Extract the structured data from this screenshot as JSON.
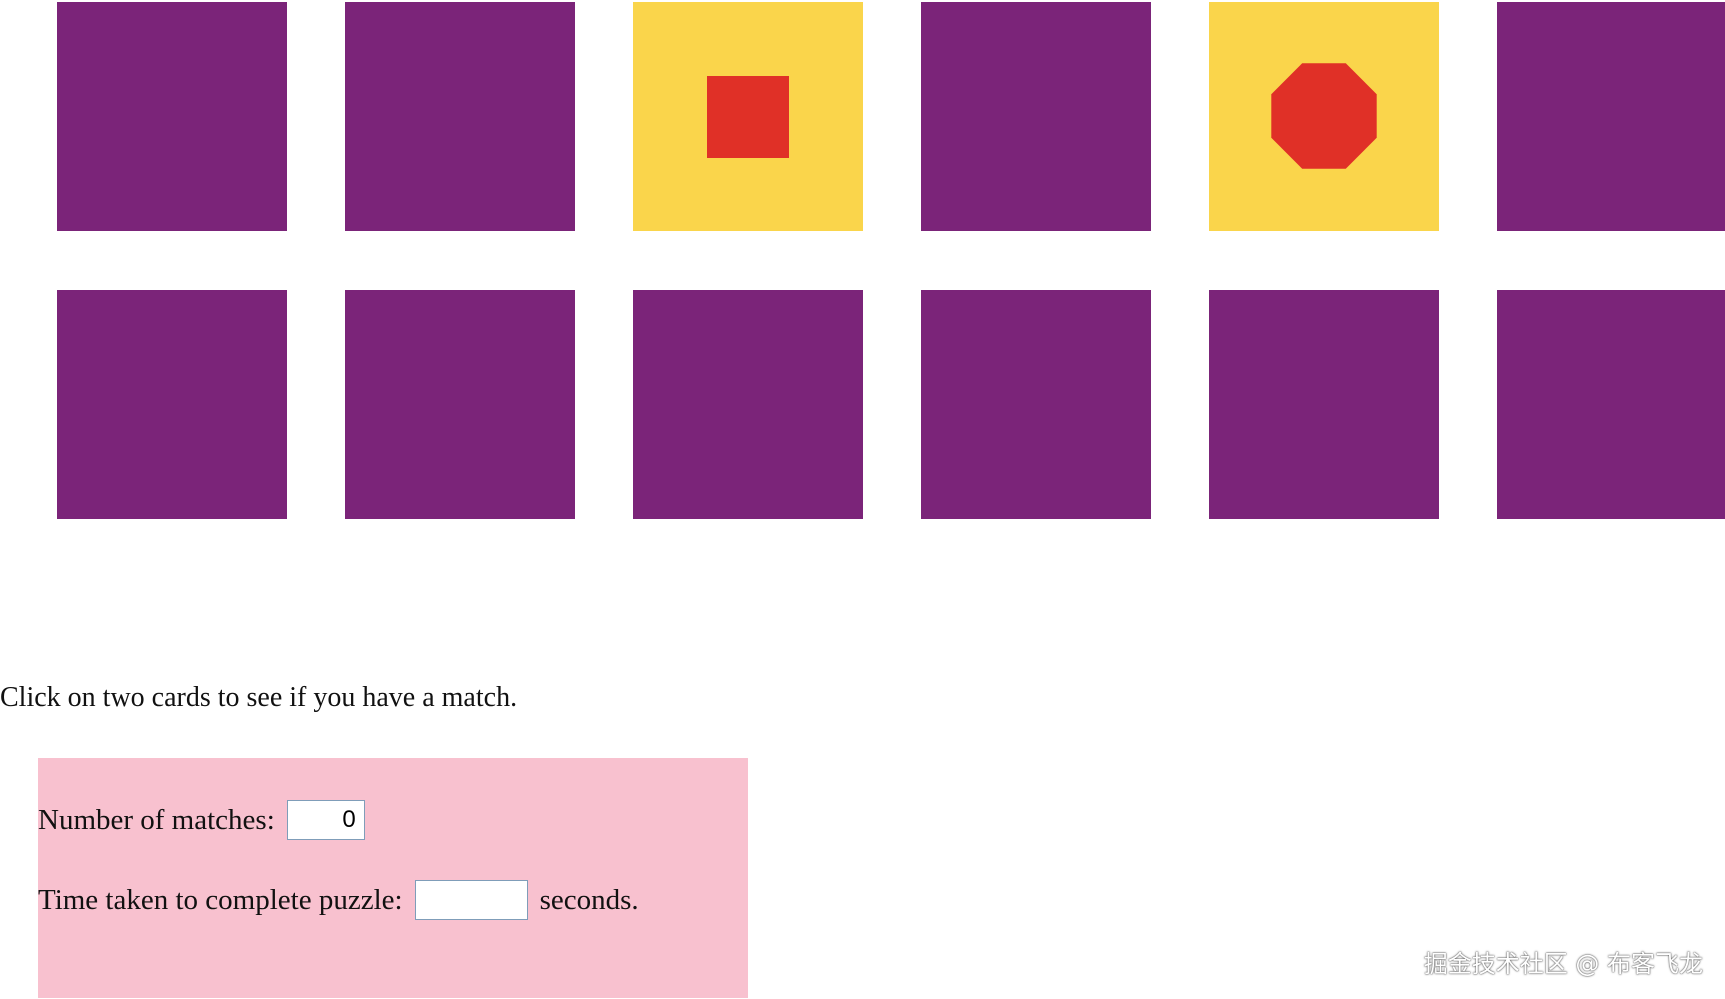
{
  "colors": {
    "card_back": "#7b2479",
    "card_face": "#fad54b",
    "shape": "#e03027",
    "panel": "#f8c1cf"
  },
  "cards": [
    {
      "state": "face-down"
    },
    {
      "state": "face-down"
    },
    {
      "state": "face-up",
      "shape": "square"
    },
    {
      "state": "face-down"
    },
    {
      "state": "face-up",
      "shape": "octagon"
    },
    {
      "state": "face-down"
    },
    {
      "state": "face-down"
    },
    {
      "state": "face-down"
    },
    {
      "state": "face-down"
    },
    {
      "state": "face-down"
    },
    {
      "state": "face-down"
    },
    {
      "state": "face-down"
    }
  ],
  "instruction": "Click on two cards to see if you have a match.",
  "stats": {
    "matches_label": "Number of matches:",
    "matches_value": "0",
    "time_label": "Time taken to complete puzzle:",
    "time_value": "",
    "time_unit": "seconds."
  },
  "watermark": "掘金技术社区 @ 布客飞龙"
}
